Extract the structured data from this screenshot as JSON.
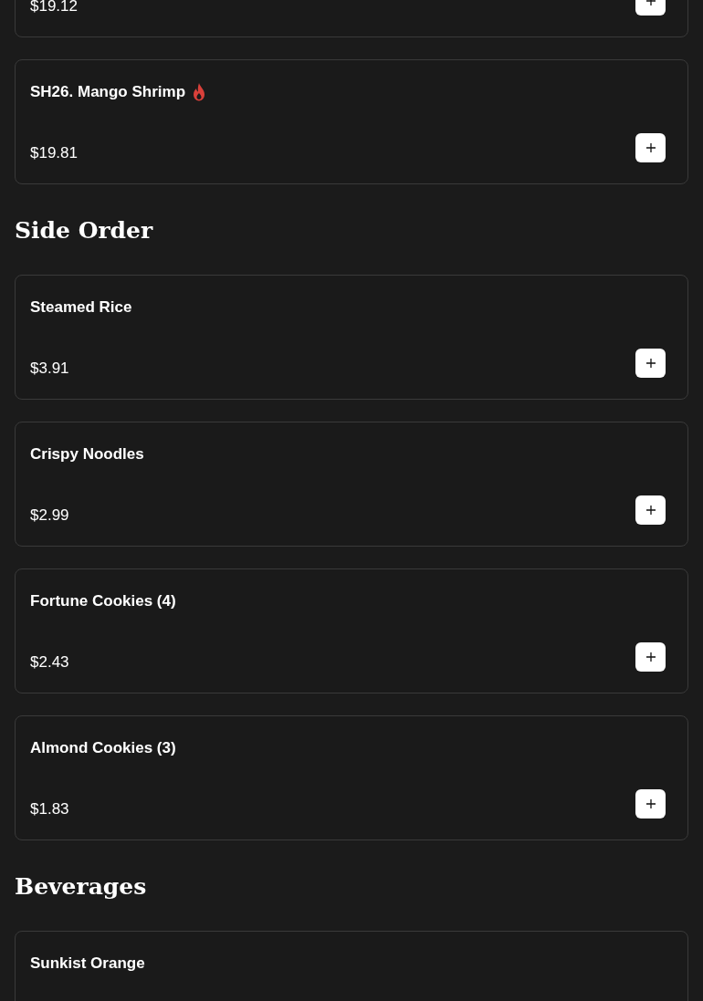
{
  "sections": [
    {
      "items": [
        {
          "price": "$19.12"
        },
        {
          "name": "SH26. Mango Shrimp",
          "spicy": true,
          "price": "$19.81"
        }
      ]
    },
    {
      "title": "Side Order",
      "items": [
        {
          "name": "Steamed Rice",
          "spicy": false,
          "price": "$3.91"
        },
        {
          "name": "Crispy Noodles",
          "spicy": false,
          "price": "$2.99"
        },
        {
          "name": "Fortune Cookies (4)",
          "spicy": false,
          "price": "$2.43"
        },
        {
          "name": "Almond Cookies (3)",
          "spicy": false,
          "price": "$1.83"
        }
      ]
    },
    {
      "title": "Beverages",
      "items": [
        {
          "name": "Sunkist Orange",
          "spicy": false
        }
      ]
    }
  ]
}
